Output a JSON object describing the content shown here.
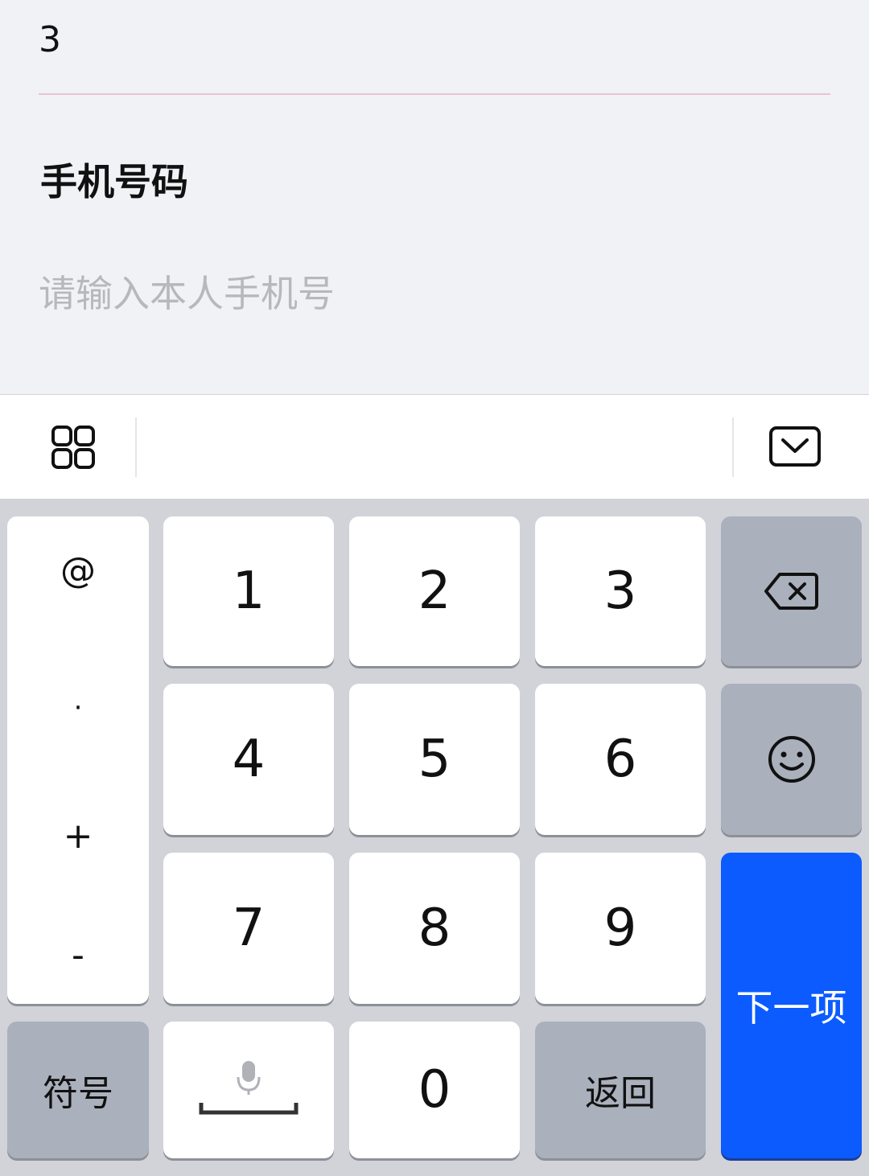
{
  "form": {
    "previous_value": "3",
    "field_label": "手机号码",
    "field_placeholder": "请输入本人手机号"
  },
  "toolbar": {
    "left_icon": "grid-icon",
    "right_icon": "keyboard-hide-icon"
  },
  "keyboard": {
    "symbols": [
      "@",
      "·",
      "+",
      "-"
    ],
    "digits": [
      "1",
      "2",
      "3",
      "4",
      "5",
      "6",
      "7",
      "8",
      "9",
      "0"
    ],
    "symbol_key_label": "符号",
    "return_key_label": "返回",
    "next_key_label": "下一项",
    "icons": {
      "backspace": "backspace-icon",
      "emoji": "smiley-icon",
      "voice_space": "microphone-space-icon"
    },
    "colors": {
      "accent": "#0b5bff",
      "function_key": "#aab0bc",
      "background": "#d1d3d9"
    }
  }
}
